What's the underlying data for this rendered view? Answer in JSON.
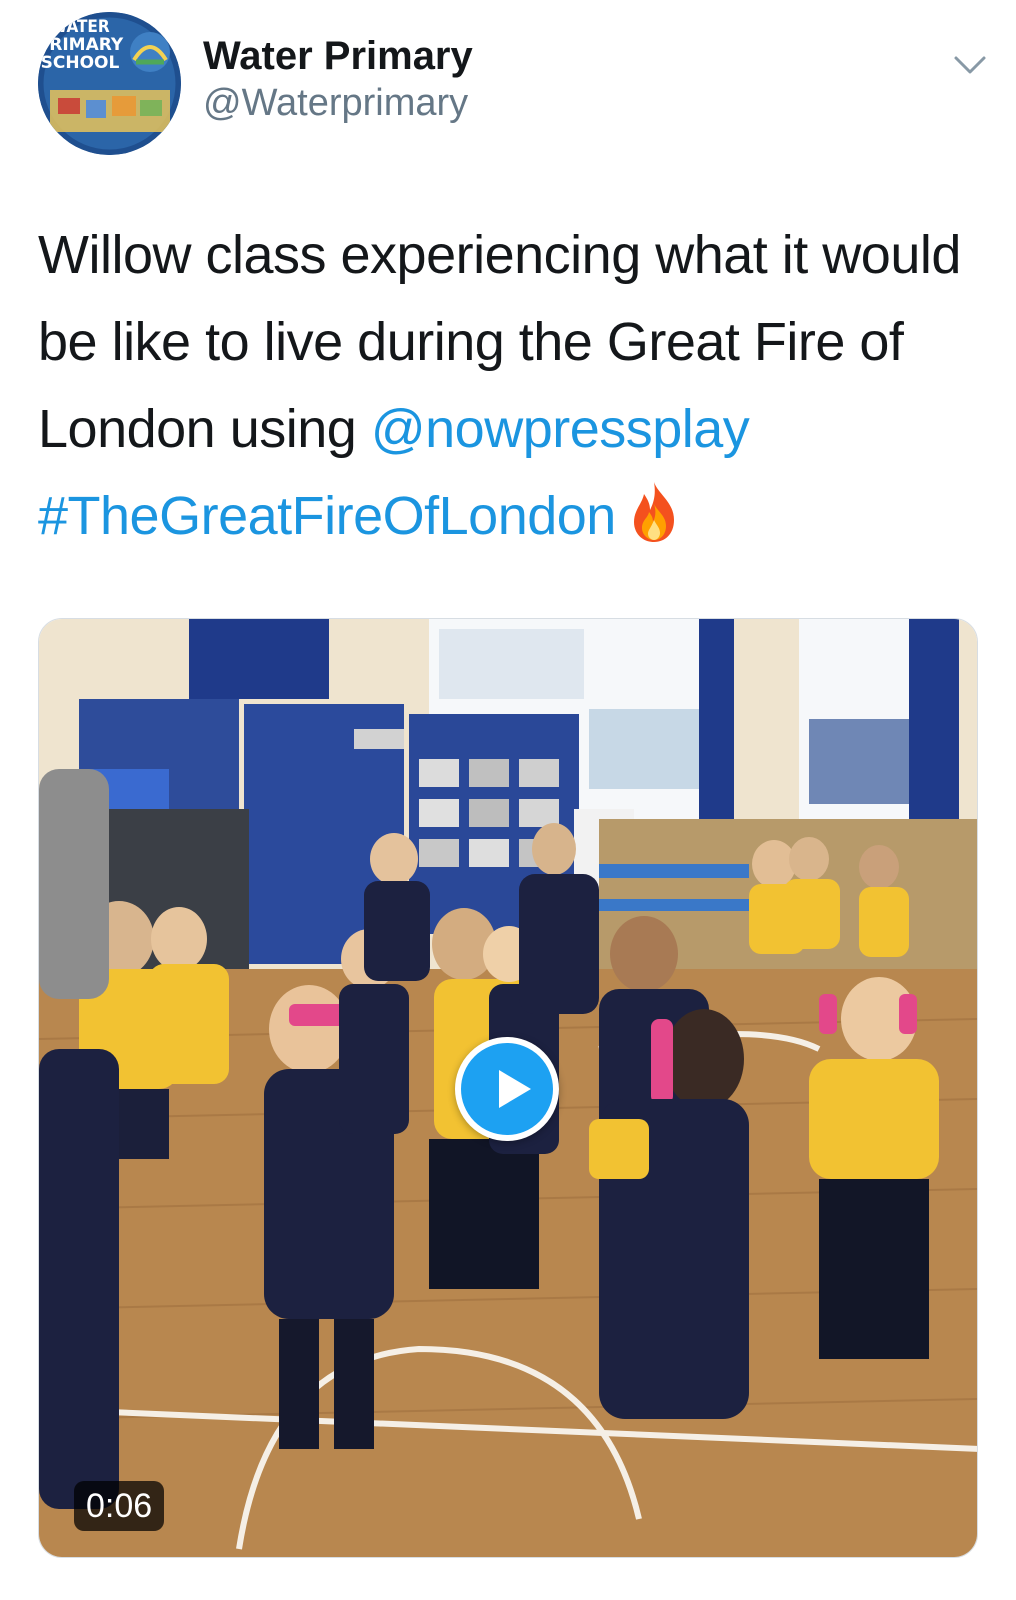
{
  "author": {
    "display_name": "Water Primary",
    "handle": "@Waterprimary",
    "avatar_logo_lines": [
      "WATER",
      "PRIMARY",
      "SCHOOL"
    ]
  },
  "tweet": {
    "text_plain": "Willow class experiencing what it would be like to live during the Great Fire of London using",
    "mention": "@nowpressplay",
    "hashtag": "#TheGreatFireOfLondon",
    "emoji": "fire-emoji"
  },
  "media": {
    "type": "video",
    "duration": "0:06",
    "play_icon": "play-icon"
  },
  "icons": {
    "menu": "chevron-down-icon"
  },
  "colors": {
    "text": "#14171a",
    "secondary": "#657786",
    "link": "#1b95e0",
    "play_button": "#1da1f2"
  }
}
